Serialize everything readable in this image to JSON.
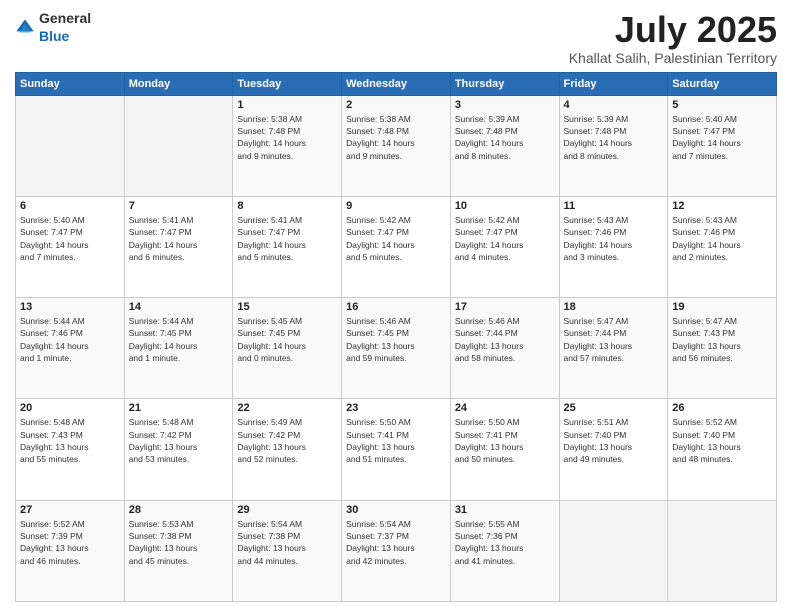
{
  "header": {
    "logo_general": "General",
    "logo_blue": "Blue",
    "title": "July 2025",
    "location": "Khallat Salih, Palestinian Territory"
  },
  "weekdays": [
    "Sunday",
    "Monday",
    "Tuesday",
    "Wednesday",
    "Thursday",
    "Friday",
    "Saturday"
  ],
  "weeks": [
    [
      {
        "day": "",
        "info": ""
      },
      {
        "day": "",
        "info": ""
      },
      {
        "day": "1",
        "info": "Sunrise: 5:38 AM\nSunset: 7:48 PM\nDaylight: 14 hours\nand 9 minutes."
      },
      {
        "day": "2",
        "info": "Sunrise: 5:38 AM\nSunset: 7:48 PM\nDaylight: 14 hours\nand 9 minutes."
      },
      {
        "day": "3",
        "info": "Sunrise: 5:39 AM\nSunset: 7:48 PM\nDaylight: 14 hours\nand 8 minutes."
      },
      {
        "day": "4",
        "info": "Sunrise: 5:39 AM\nSunset: 7:48 PM\nDaylight: 14 hours\nand 8 minutes."
      },
      {
        "day": "5",
        "info": "Sunrise: 5:40 AM\nSunset: 7:47 PM\nDaylight: 14 hours\nand 7 minutes."
      }
    ],
    [
      {
        "day": "6",
        "info": "Sunrise: 5:40 AM\nSunset: 7:47 PM\nDaylight: 14 hours\nand 7 minutes."
      },
      {
        "day": "7",
        "info": "Sunrise: 5:41 AM\nSunset: 7:47 PM\nDaylight: 14 hours\nand 6 minutes."
      },
      {
        "day": "8",
        "info": "Sunrise: 5:41 AM\nSunset: 7:47 PM\nDaylight: 14 hours\nand 5 minutes."
      },
      {
        "day": "9",
        "info": "Sunrise: 5:42 AM\nSunset: 7:47 PM\nDaylight: 14 hours\nand 5 minutes."
      },
      {
        "day": "10",
        "info": "Sunrise: 5:42 AM\nSunset: 7:47 PM\nDaylight: 14 hours\nand 4 minutes."
      },
      {
        "day": "11",
        "info": "Sunrise: 5:43 AM\nSunset: 7:46 PM\nDaylight: 14 hours\nand 3 minutes."
      },
      {
        "day": "12",
        "info": "Sunrise: 5:43 AM\nSunset: 7:46 PM\nDaylight: 14 hours\nand 2 minutes."
      }
    ],
    [
      {
        "day": "13",
        "info": "Sunrise: 5:44 AM\nSunset: 7:46 PM\nDaylight: 14 hours\nand 1 minute."
      },
      {
        "day": "14",
        "info": "Sunrise: 5:44 AM\nSunset: 7:45 PM\nDaylight: 14 hours\nand 1 minute."
      },
      {
        "day": "15",
        "info": "Sunrise: 5:45 AM\nSunset: 7:45 PM\nDaylight: 14 hours\nand 0 minutes."
      },
      {
        "day": "16",
        "info": "Sunrise: 5:46 AM\nSunset: 7:45 PM\nDaylight: 13 hours\nand 59 minutes."
      },
      {
        "day": "17",
        "info": "Sunrise: 5:46 AM\nSunset: 7:44 PM\nDaylight: 13 hours\nand 58 minutes."
      },
      {
        "day": "18",
        "info": "Sunrise: 5:47 AM\nSunset: 7:44 PM\nDaylight: 13 hours\nand 57 minutes."
      },
      {
        "day": "19",
        "info": "Sunrise: 5:47 AM\nSunset: 7:43 PM\nDaylight: 13 hours\nand 56 minutes."
      }
    ],
    [
      {
        "day": "20",
        "info": "Sunrise: 5:48 AM\nSunset: 7:43 PM\nDaylight: 13 hours\nand 55 minutes."
      },
      {
        "day": "21",
        "info": "Sunrise: 5:48 AM\nSunset: 7:42 PM\nDaylight: 13 hours\nand 53 minutes."
      },
      {
        "day": "22",
        "info": "Sunrise: 5:49 AM\nSunset: 7:42 PM\nDaylight: 13 hours\nand 52 minutes."
      },
      {
        "day": "23",
        "info": "Sunrise: 5:50 AM\nSunset: 7:41 PM\nDaylight: 13 hours\nand 51 minutes."
      },
      {
        "day": "24",
        "info": "Sunrise: 5:50 AM\nSunset: 7:41 PM\nDaylight: 13 hours\nand 50 minutes."
      },
      {
        "day": "25",
        "info": "Sunrise: 5:51 AM\nSunset: 7:40 PM\nDaylight: 13 hours\nand 49 minutes."
      },
      {
        "day": "26",
        "info": "Sunrise: 5:52 AM\nSunset: 7:40 PM\nDaylight: 13 hours\nand 48 minutes."
      }
    ],
    [
      {
        "day": "27",
        "info": "Sunrise: 5:52 AM\nSunset: 7:39 PM\nDaylight: 13 hours\nand 46 minutes."
      },
      {
        "day": "28",
        "info": "Sunrise: 5:53 AM\nSunset: 7:38 PM\nDaylight: 13 hours\nand 45 minutes."
      },
      {
        "day": "29",
        "info": "Sunrise: 5:54 AM\nSunset: 7:38 PM\nDaylight: 13 hours\nand 44 minutes."
      },
      {
        "day": "30",
        "info": "Sunrise: 5:54 AM\nSunset: 7:37 PM\nDaylight: 13 hours\nand 42 minutes."
      },
      {
        "day": "31",
        "info": "Sunrise: 5:55 AM\nSunset: 7:36 PM\nDaylight: 13 hours\nand 41 minutes."
      },
      {
        "day": "",
        "info": ""
      },
      {
        "day": "",
        "info": ""
      }
    ]
  ]
}
